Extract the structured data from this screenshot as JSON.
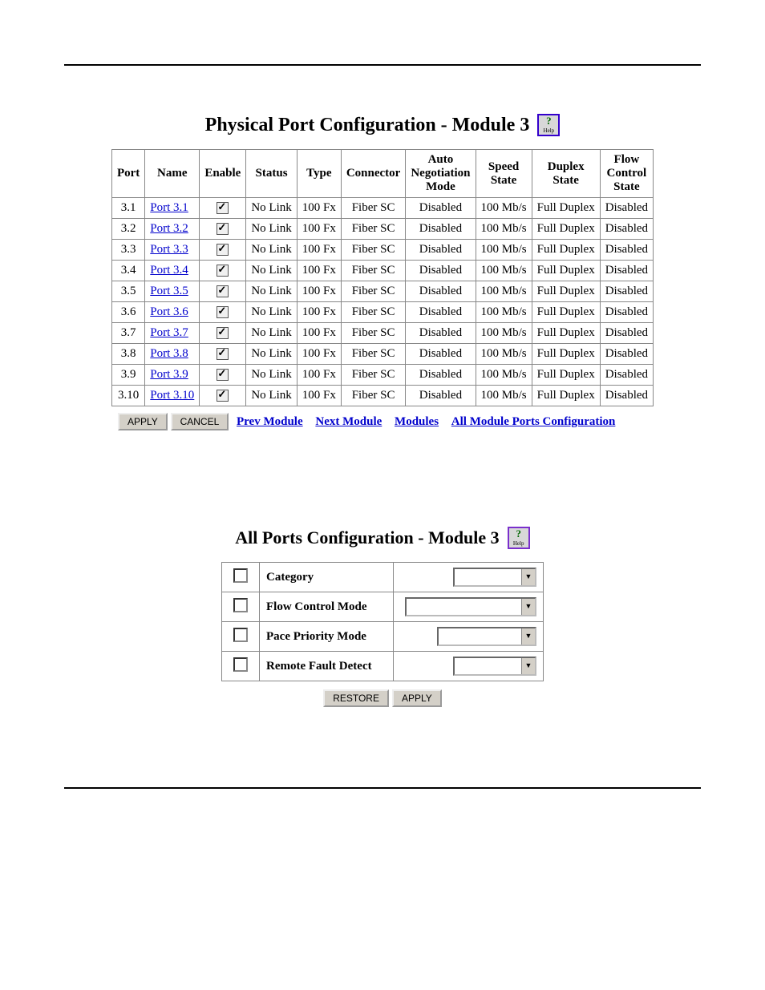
{
  "section1": {
    "title": "Physical Port Configuration - Module 3",
    "help_label": "Help",
    "headers": [
      "Port",
      "Name",
      "Enable",
      "Status",
      "Type",
      "Connector",
      "Auto Negotiation Mode",
      "Speed State",
      "Duplex State",
      "Flow Control State"
    ],
    "rows": [
      {
        "port": "3.1",
        "name": "Port 3.1",
        "enabled": true,
        "status": "No Link",
        "type": "100 Fx",
        "connector": "Fiber SC",
        "aneg": "Disabled",
        "speed": "100 Mb/s",
        "duplex": "Full Duplex",
        "flow": "Disabled"
      },
      {
        "port": "3.2",
        "name": "Port 3.2",
        "enabled": true,
        "status": "No Link",
        "type": "100 Fx",
        "connector": "Fiber SC",
        "aneg": "Disabled",
        "speed": "100 Mb/s",
        "duplex": "Full Duplex",
        "flow": "Disabled"
      },
      {
        "port": "3.3",
        "name": "Port 3.3",
        "enabled": true,
        "status": "No Link",
        "type": "100 Fx",
        "connector": "Fiber SC",
        "aneg": "Disabled",
        "speed": "100 Mb/s",
        "duplex": "Full Duplex",
        "flow": "Disabled"
      },
      {
        "port": "3.4",
        "name": "Port 3.4",
        "enabled": true,
        "status": "No Link",
        "type": "100 Fx",
        "connector": "Fiber SC",
        "aneg": "Disabled",
        "speed": "100 Mb/s",
        "duplex": "Full Duplex",
        "flow": "Disabled"
      },
      {
        "port": "3.5",
        "name": "Port 3.5",
        "enabled": true,
        "status": "No Link",
        "type": "100 Fx",
        "connector": "Fiber SC",
        "aneg": "Disabled",
        "speed": "100 Mb/s",
        "duplex": "Full Duplex",
        "flow": "Disabled"
      },
      {
        "port": "3.6",
        "name": "Port 3.6",
        "enabled": true,
        "status": "No Link",
        "type": "100 Fx",
        "connector": "Fiber SC",
        "aneg": "Disabled",
        "speed": "100 Mb/s",
        "duplex": "Full Duplex",
        "flow": "Disabled"
      },
      {
        "port": "3.7",
        "name": "Port 3.7",
        "enabled": true,
        "status": "No Link",
        "type": "100 Fx",
        "connector": "Fiber SC",
        "aneg": "Disabled",
        "speed": "100 Mb/s",
        "duplex": "Full Duplex",
        "flow": "Disabled"
      },
      {
        "port": "3.8",
        "name": "Port 3.8",
        "enabled": true,
        "status": "No Link",
        "type": "100 Fx",
        "connector": "Fiber SC",
        "aneg": "Disabled",
        "speed": "100 Mb/s",
        "duplex": "Full Duplex",
        "flow": "Disabled"
      },
      {
        "port": "3.9",
        "name": "Port 3.9",
        "enabled": true,
        "status": "No Link",
        "type": "100 Fx",
        "connector": "Fiber SC",
        "aneg": "Disabled",
        "speed": "100 Mb/s",
        "duplex": "Full Duplex",
        "flow": "Disabled"
      },
      {
        "port": "3.10",
        "name": "Port 3.10",
        "enabled": true,
        "status": "No Link",
        "type": "100 Fx",
        "connector": "Fiber SC",
        "aneg": "Disabled",
        "speed": "100 Mb/s",
        "duplex": "Full Duplex",
        "flow": "Disabled"
      }
    ],
    "nav": {
      "apply": "APPLY",
      "cancel": "CANCEL",
      "prev": "Prev Module",
      "next": "Next Module",
      "modules": "Modules",
      "allmod": "All Module Ports Configuration"
    }
  },
  "section2": {
    "title": "All Ports Configuration - Module 3",
    "help_label": "Help",
    "rows": [
      {
        "label": "Category",
        "dd_width": 100
      },
      {
        "label": "Flow Control Mode",
        "dd_width": 160
      },
      {
        "label": "Pace Priority Mode",
        "dd_width": 120
      },
      {
        "label": "Remote Fault Detect",
        "dd_width": 100
      }
    ],
    "buttons": {
      "restore": "RESTORE",
      "apply": "APPLY"
    }
  }
}
